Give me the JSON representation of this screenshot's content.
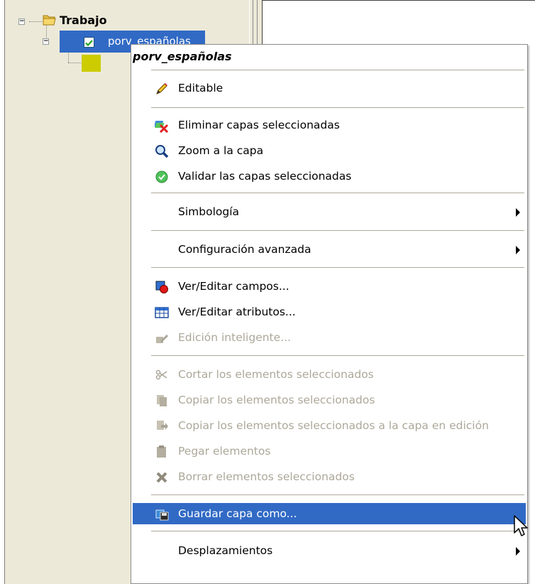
{
  "tree": {
    "group": {
      "label": "Trabajo",
      "expander": "−"
    },
    "layer": {
      "label": "porv_españolas",
      "checked": true,
      "expander": "−",
      "swatch_color": "#cccc00"
    }
  },
  "menu": {
    "header": "porv_españolas",
    "items": [
      {
        "label": "Editable",
        "icon": "pencil-icon",
        "enabled": true
      },
      {
        "label": "Eliminar capas seleccionadas",
        "icon": "delete-layers-icon",
        "enabled": true
      },
      {
        "label": "Zoom a la capa",
        "icon": "magnifier-icon",
        "enabled": true
      },
      {
        "label": "Validar las capas seleccionadas",
        "icon": "check-circle-icon",
        "enabled": true
      },
      {
        "label": "Simbología",
        "submenu": true,
        "enabled": true
      },
      {
        "label": "Configuración avanzada",
        "submenu": true,
        "enabled": true
      },
      {
        "label": "Ver/Editar campos...",
        "icon": "fields-icon",
        "enabled": true
      },
      {
        "label": "Ver/Editar atributos...",
        "icon": "table-icon",
        "enabled": true
      },
      {
        "label": "Edición inteligente...",
        "icon": "smart-edit-icon",
        "enabled": false
      },
      {
        "label": "Cortar los elementos seleccionados",
        "icon": "scissors-icon",
        "enabled": false
      },
      {
        "label": "Copiar los elementos seleccionados",
        "icon": "copy-icon",
        "enabled": false
      },
      {
        "label": "Copiar los elementos seleccionados a la capa en edición",
        "icon": "copy-to-layer-icon",
        "enabled": false
      },
      {
        "label": "Pegar elementos",
        "icon": "paste-icon",
        "enabled": false
      },
      {
        "label": "Borrar elementos seleccionados",
        "icon": "x-icon",
        "enabled": false
      },
      {
        "label": "Guardar capa como...",
        "icon": "save-layer-icon",
        "enabled": true,
        "highlighted": true
      },
      {
        "label": "Desplazamientos",
        "submenu": true,
        "enabled": true
      }
    ]
  },
  "colors": {
    "selection": "#316ac5",
    "disabled_text": "#aca899",
    "panel": "#ece9d8"
  }
}
